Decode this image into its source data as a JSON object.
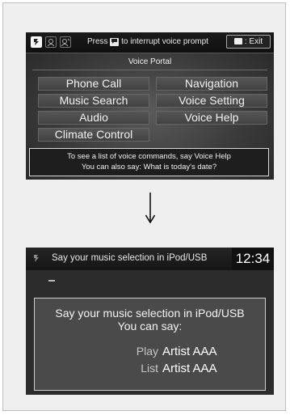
{
  "screen1": {
    "press_prefix": "Press",
    "talk_glyph": "💬",
    "press_suffix": "to interrupt voice prompt",
    "exit_label": ": Exit",
    "title": "Voice Portal",
    "menu": {
      "phone_call": "Phone Call",
      "navigation": "Navigation",
      "music_search": "Music Search",
      "voice_setting": "Voice Setting",
      "audio": "Audio",
      "voice_help": "Voice Help",
      "climate_control": "Climate Control"
    },
    "hint_line1": "To see a list of voice commands, say Voice Help",
    "hint_line2": "You can also say: What is today's date?",
    "icons": [
      "voice-icon",
      "voice-icon",
      "voice-icon"
    ]
  },
  "arrow": "↓",
  "screen2": {
    "title": "Say your music selection in iPod/USB",
    "clock": "12:34",
    "dash": "–",
    "prompt_line1": "Say your music selection in iPod/USB",
    "prompt_line2": "You can say:",
    "commands": [
      {
        "verb": "Play",
        "target": "Artist AAA"
      },
      {
        "verb": "List",
        "target": "Artist AAA"
      }
    ]
  }
}
